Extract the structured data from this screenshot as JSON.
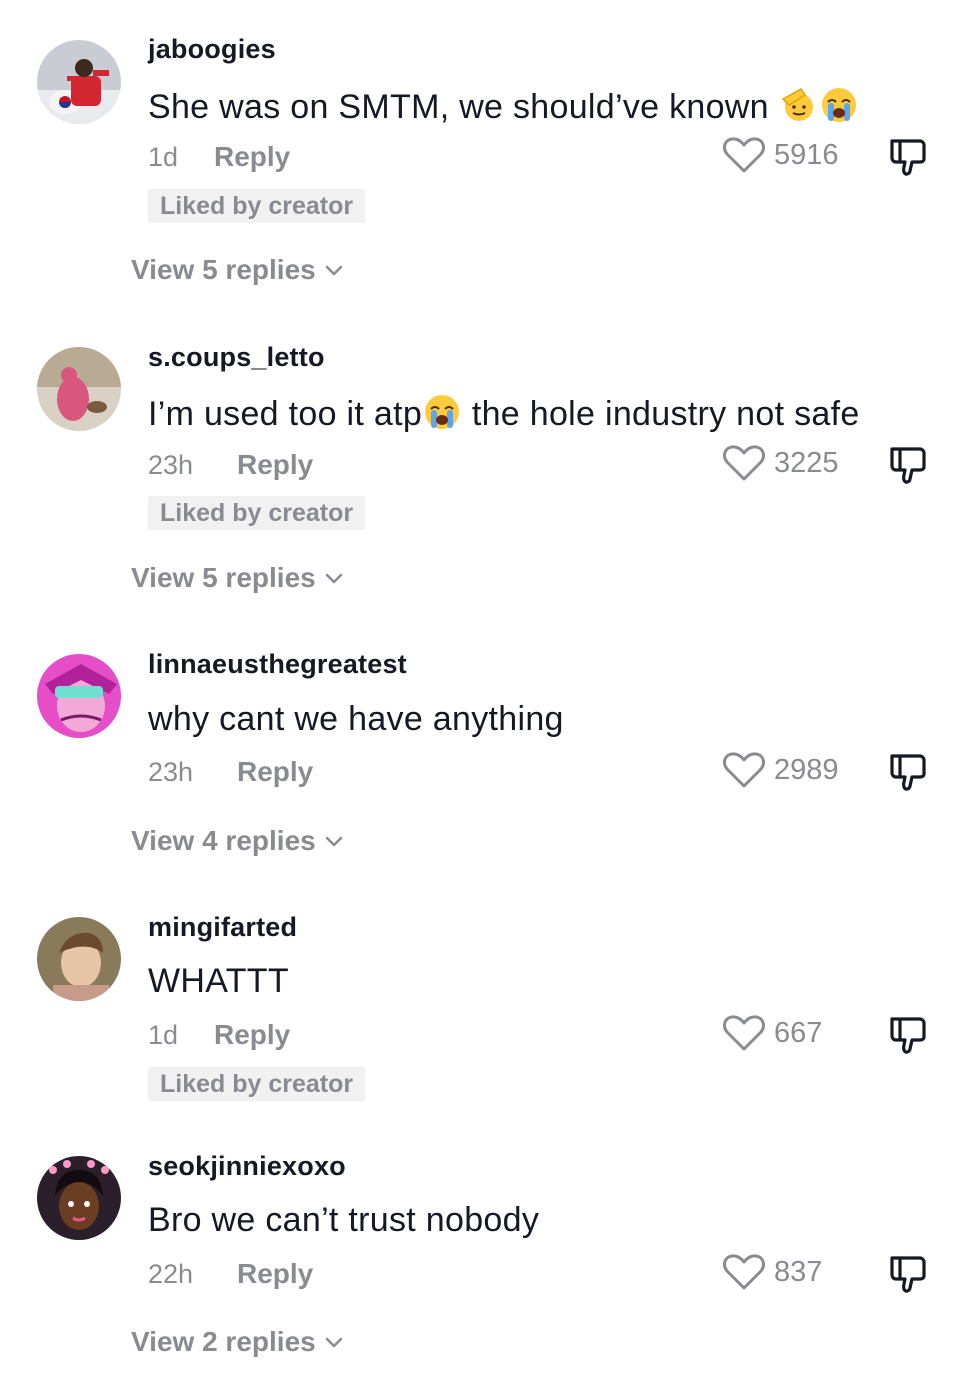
{
  "comments": [
    {
      "username": "jaboogies",
      "text": "She was on SMTM, we should’ve known ",
      "emojis": [
        "saluting-face-emoji",
        "loudly-crying-face-emoji"
      ],
      "time": "1d",
      "reply_label": "Reply",
      "liked_by_creator": "Liked by creator",
      "likes": "5916",
      "view_replies": "View 5 replies"
    },
    {
      "username": "s.coups_letto",
      "text_before": "I’m used too it atp",
      "text_after": " the hole industry not safe",
      "emojis": [
        "loudly-crying-face-emoji"
      ],
      "time": "23h",
      "reply_label": "Reply",
      "liked_by_creator": "Liked by creator",
      "likes": "3225",
      "view_replies": "View 5 replies"
    },
    {
      "username": "linnaeusthegreatest",
      "text": "why cant we have anything",
      "time": "23h",
      "reply_label": "Reply",
      "likes": "2989",
      "view_replies": "View 4 replies"
    },
    {
      "username": "mingifarted",
      "text": "WHATTT",
      "time": "1d",
      "reply_label": "Reply",
      "liked_by_creator": "Liked by creator",
      "likes": "667"
    },
    {
      "username": "seokjinniexoxo",
      "text": "Bro we can’t trust nobody",
      "time": "22h",
      "reply_label": "Reply",
      "likes": "837",
      "view_replies": "View 2 replies"
    }
  ],
  "colors": {
    "primary_text": "#161823",
    "secondary_text": "#8a8b91",
    "badge_bg": "#f1f1f2"
  },
  "icons": [
    "heart-icon",
    "dislike-icon",
    "chevron-down-icon"
  ]
}
